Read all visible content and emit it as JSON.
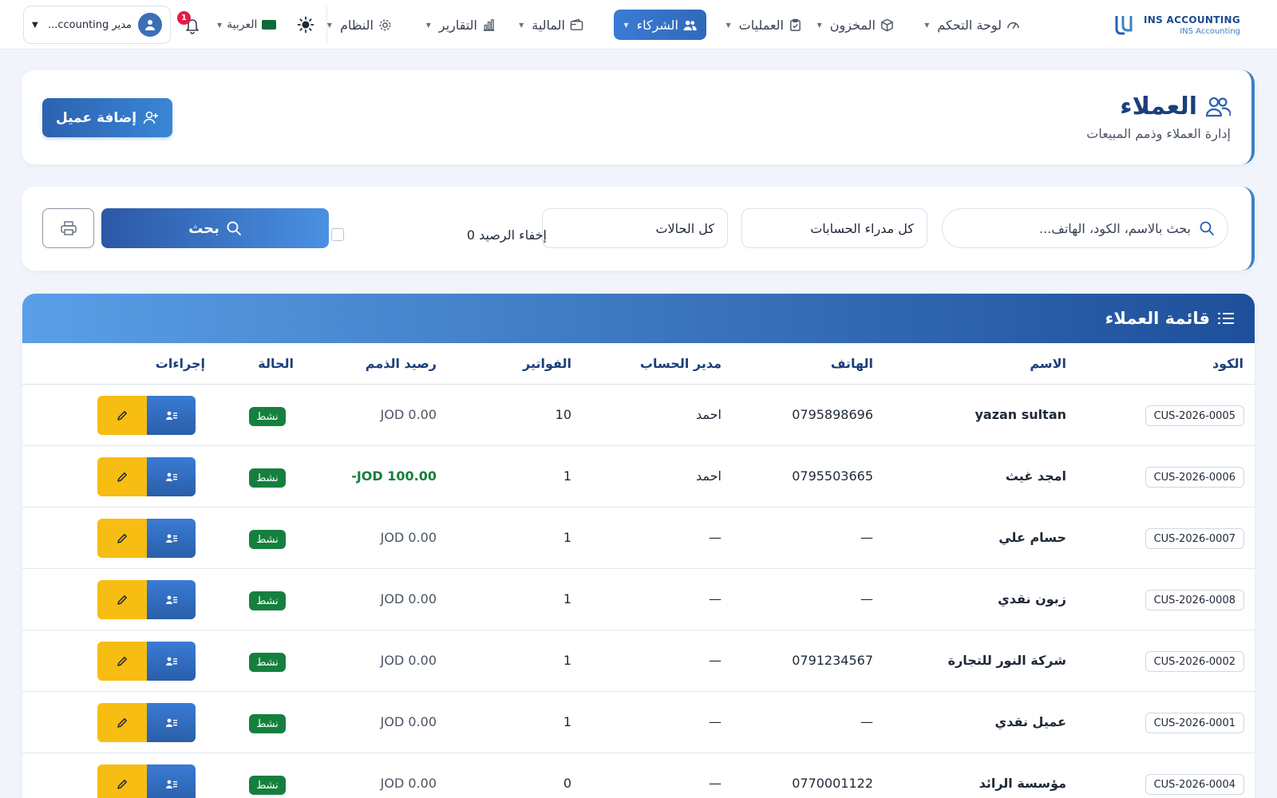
{
  "brand": {
    "name": "INS ACCOUNTING",
    "sub": "INS Accounting"
  },
  "nav": [
    {
      "label": "لوحة التحكم",
      "icon": "gauge-icon",
      "active": false
    },
    {
      "label": "المخزون",
      "icon": "box-icon",
      "active": false
    },
    {
      "label": "العمليات",
      "icon": "clipboard-check-icon",
      "active": false
    },
    {
      "label": "الشركاء",
      "icon": "users-icon",
      "active": true
    },
    {
      "label": "المالية",
      "icon": "wallet-icon",
      "active": false
    },
    {
      "label": "التقارير",
      "icon": "bar-chart-icon",
      "active": false
    },
    {
      "label": "النظام",
      "icon": "gear-icon",
      "active": false
    }
  ],
  "topbar": {
    "language": "العربية",
    "notifications_count": "1",
    "user_label": "مدير ccounting..."
  },
  "page": {
    "title": "العملاء",
    "subtitle": "إدارة العملاء وذمم المبيعات",
    "add_button": "إضافة عميل"
  },
  "filters": {
    "search_placeholder": "بحث بالاسم، الكود، الهاتف...",
    "account_manager": "كل مدراء الحسابات",
    "status": "كل الحالات",
    "hide_balance": "إخفاء الرصيد 0",
    "search_button": "بحث"
  },
  "table": {
    "title": "قائمة العملاء",
    "columns": {
      "code": "الكود",
      "name": "الاسم",
      "phone": "الهاتف",
      "manager": "مدير الحساب",
      "invoices": "الفواتير",
      "balance": "رصيد الذمم",
      "status": "الحالة",
      "actions": "إجراءات"
    },
    "rows": [
      {
        "code": "CUS-2026-0005",
        "name": "yazan sultan",
        "phone": "0795898696",
        "manager": "احمد",
        "invoices": "10",
        "balance": "JOD 0.00",
        "negative": false,
        "status": "نشط"
      },
      {
        "code": "CUS-2026-0006",
        "name": "امجد غيث",
        "phone": "0795503665",
        "manager": "احمد",
        "invoices": "1",
        "balance": "-JOD 100.00",
        "negative": true,
        "status": "نشط"
      },
      {
        "code": "CUS-2026-0007",
        "name": "حسام علي",
        "phone": "—",
        "manager": "—",
        "invoices": "1",
        "balance": "JOD 0.00",
        "negative": false,
        "status": "نشط"
      },
      {
        "code": "CUS-2026-0008",
        "name": "زبون نقدي",
        "phone": "—",
        "manager": "—",
        "invoices": "1",
        "balance": "JOD 0.00",
        "negative": false,
        "status": "نشط"
      },
      {
        "code": "CUS-2026-0002",
        "name": "شركة النور للتجارة",
        "phone": "0791234567",
        "manager": "—",
        "invoices": "1",
        "balance": "JOD 0.00",
        "negative": false,
        "status": "نشط"
      },
      {
        "code": "CUS-2026-0001",
        "name": "عميل نقدي",
        "phone": "—",
        "manager": "—",
        "invoices": "1",
        "balance": "JOD 0.00",
        "negative": false,
        "status": "نشط"
      },
      {
        "code": "CUS-2026-0004",
        "name": "مؤسسة الرائد",
        "phone": "0770001122",
        "manager": "—",
        "invoices": "0",
        "balance": "JOD 0.00",
        "negative": false,
        "status": "نشط"
      }
    ]
  },
  "colors": {
    "primary": "#2f6ab9",
    "title": "#1c3f7a",
    "status_active": "#15803d",
    "edit_button": "#f7bd12",
    "badge": "#e11d48"
  }
}
